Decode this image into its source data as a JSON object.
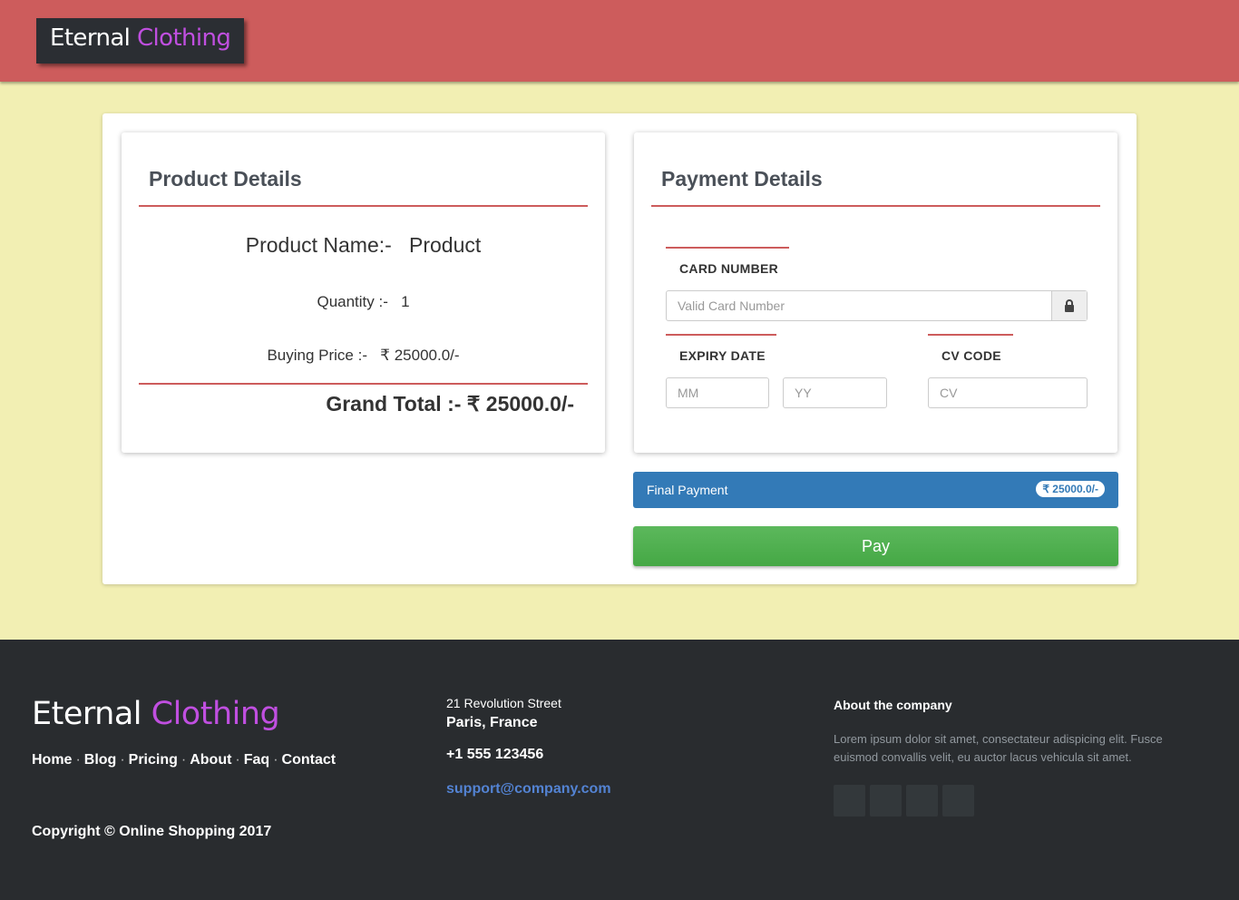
{
  "header": {
    "brand_part1": "Eternal",
    "brand_part2": "Clothing"
  },
  "product": {
    "title": "Product Details",
    "name_label": "Product Name:-",
    "name_value": "Product",
    "quantity_label": "Quantity :-",
    "quantity_value": "1",
    "price_label": "Buying Price :-",
    "price_value": "₹ 25000.0/-",
    "grand_total": "Grand Total :- ₹ 25000.0/-"
  },
  "payment": {
    "title": "Payment Details",
    "card_number_label": "CARD NUMBER",
    "card_number_placeholder": "Valid Card Number",
    "expiry_label": "EXPIRY DATE",
    "mm_placeholder": "MM",
    "yy_placeholder": "YY",
    "cv_label": "CV CODE",
    "cv_placeholder": "CV",
    "final_label": "Final Payment",
    "final_amount": "₹ 25000.0/-",
    "pay_label": "Pay"
  },
  "footer": {
    "brand_part1": "Eternal",
    "brand_part2": "Clothing",
    "links": [
      "Home",
      "Blog",
      "Pricing",
      "About",
      "Faq",
      "Contact"
    ],
    "copyright": "Copyright © Online Shopping 2017",
    "street": "21 Revolution Street",
    "city": "Paris, France",
    "phone": "+1 555 123456",
    "email": "support@company.com",
    "about_title": "About the company",
    "about_text": "Lorem ipsum dolor sit amet, consectateur adispicing elit. Fusce euismod convallis velit, eu auctor lacus vehicula sit amet."
  },
  "colors": {
    "header_bg": "#cd5c5c",
    "page_bg": "#f2efb3",
    "brand_accent": "#c04fe0",
    "final_bar": "#337ab7",
    "pay_button": "#5cb85c",
    "footer_bg": "#292c2f",
    "email_link": "#5383d3"
  },
  "icons": {
    "card_addon": "lock-icon"
  }
}
